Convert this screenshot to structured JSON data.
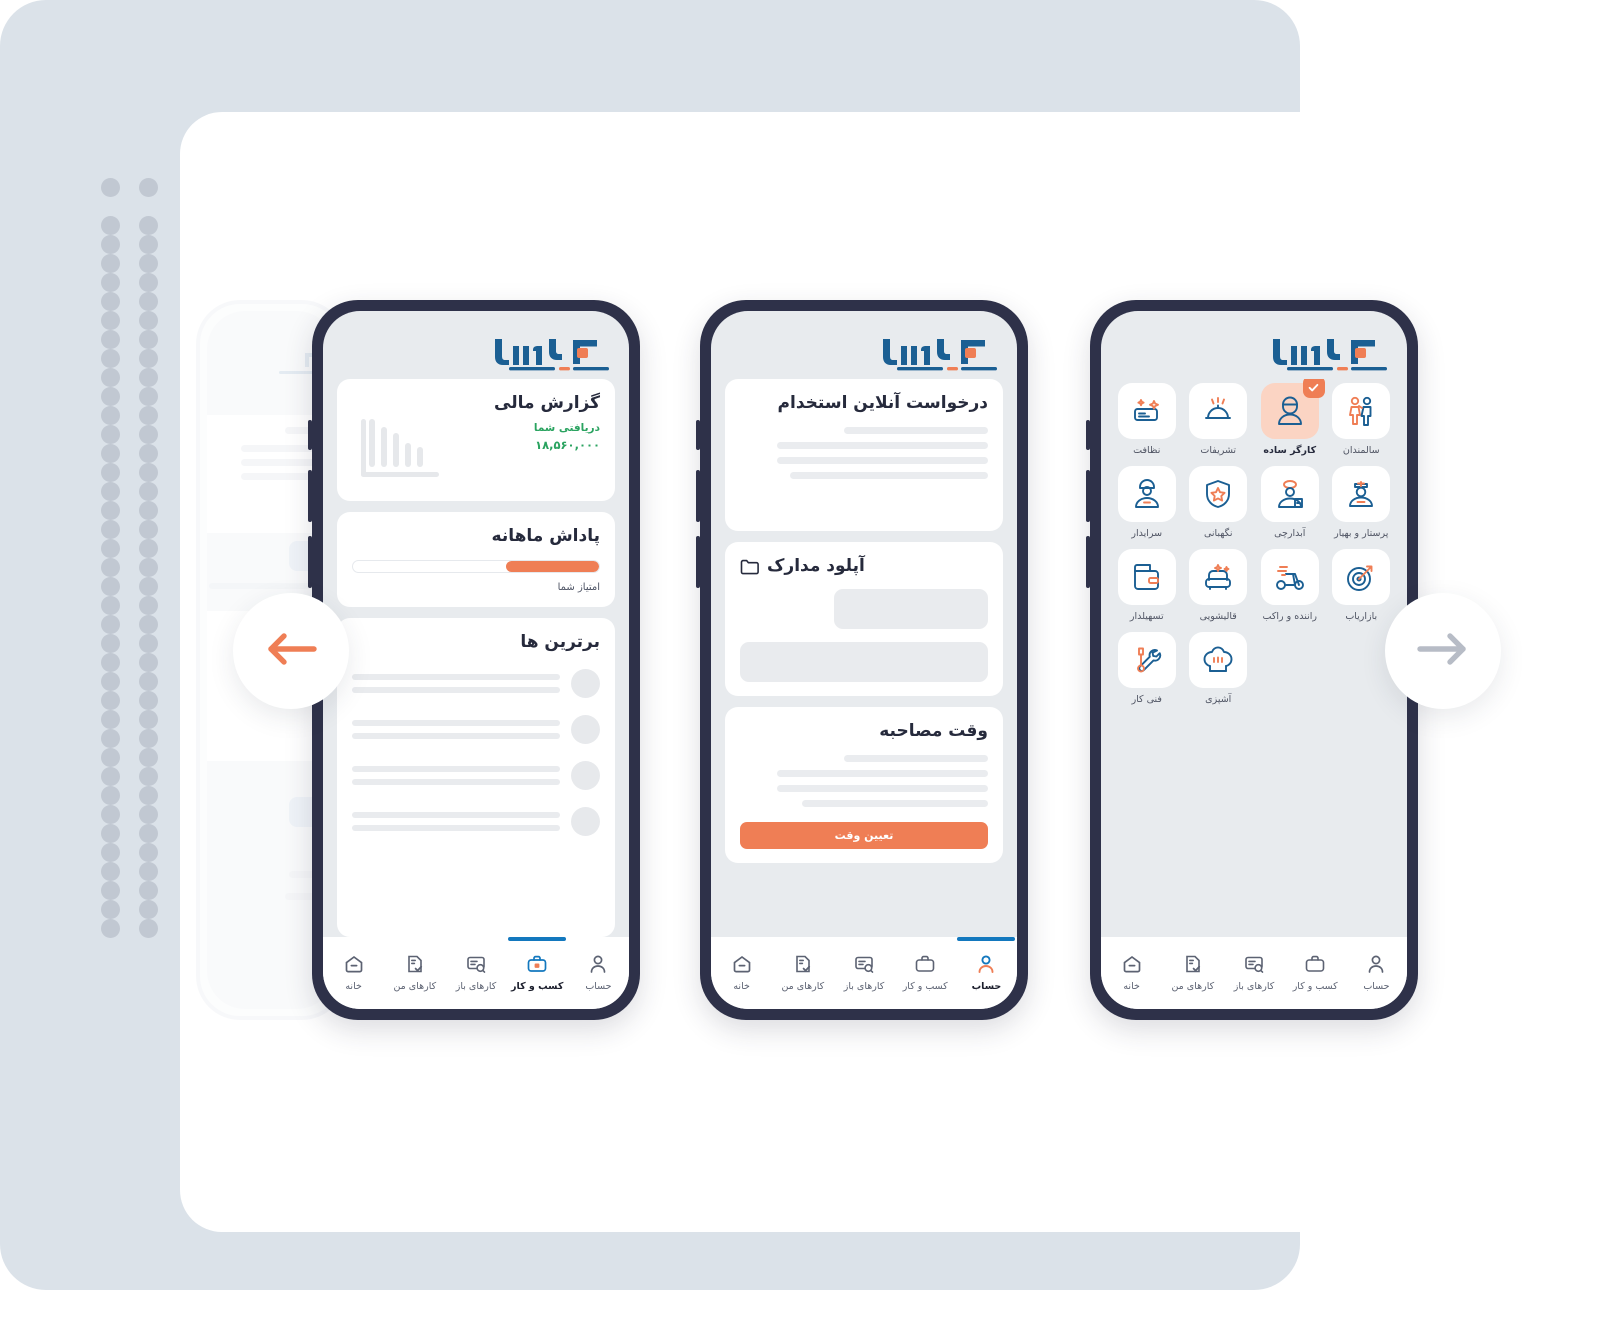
{
  "brand": {
    "name": "کارلاین",
    "colors": {
      "blue": "#1b5f93",
      "orange": "#ef7e55",
      "dark": "#2e3149",
      "green": "#2aa360"
    }
  },
  "carousel": {
    "prev_label": "قبلی",
    "next_label": "بعدی",
    "prev_icon": "arrow-left-icon",
    "next_icon": "arrow-right-icon"
  },
  "bottom_nav": {
    "items": [
      {
        "label": "حساب",
        "icon": "user-icon"
      },
      {
        "label": "کسب و کار",
        "icon": "briefcase-icon"
      },
      {
        "label": "کارهای باز",
        "icon": "document-search-icon"
      },
      {
        "label": "کارهای من",
        "icon": "document-check-icon"
      },
      {
        "label": "خانه",
        "icon": "home-icon"
      }
    ]
  },
  "screens": [
    {
      "id": "business-dashboard",
      "active_nav": "کسب و کار",
      "cards": [
        {
          "id": "financial-report",
          "title": "گزارش مالی",
          "subtitle": "دریافتی شما",
          "amount": "۱۸,۵۶۰,۰۰۰",
          "chart_icon": "bar-chart-icon"
        },
        {
          "id": "monthly-bonus",
          "title": "پاداش ماهانه",
          "progress_label": "امتیاز شما",
          "progress_percent": 38
        },
        {
          "id": "top-performers",
          "title": "برترین ها",
          "rows": 4
        }
      ]
    },
    {
      "id": "hiring-request",
      "active_nav": "حساب",
      "cards": [
        {
          "id": "online-hiring-request",
          "title": "درخواست آنلاین استخدام",
          "lines": 4
        },
        {
          "id": "upload-documents",
          "title": "آپلود مدارک",
          "icon": "folder-icon",
          "boxes": 2
        },
        {
          "id": "interview-time",
          "title": "وقت مصاحبه",
          "lines": 4,
          "button_label": "تعیین وقت"
        }
      ]
    },
    {
      "id": "service-categories",
      "active_nav": null,
      "categories": [
        {
          "label": "سالمندان",
          "icon": "elderly-care-icon",
          "selected": false
        },
        {
          "label": "کارگر ساده",
          "icon": "worker-icon",
          "selected": true
        },
        {
          "label": "تشریفات",
          "icon": "service-bell-icon",
          "selected": false
        },
        {
          "label": "نظافت",
          "icon": "cleaning-icon",
          "selected": false
        },
        {
          "label": "پرستار و بهیار",
          "icon": "nurse-icon",
          "selected": false
        },
        {
          "label": "آبدارچی",
          "icon": "tea-server-icon",
          "selected": false
        },
        {
          "label": "نگهبانی",
          "icon": "shield-badge-icon",
          "selected": false
        },
        {
          "label": "سرایدار",
          "icon": "caretaker-icon",
          "selected": false
        },
        {
          "label": "بازاریاب",
          "icon": "target-dart-icon",
          "selected": false
        },
        {
          "label": "راننده و راکب",
          "icon": "scooter-icon",
          "selected": false
        },
        {
          "label": "قالیشویی",
          "icon": "sofa-clean-icon",
          "selected": false
        },
        {
          "label": "تسهیلدار",
          "icon": "wallet-icon",
          "selected": false
        },
        {
          "label": "آشپزی",
          "icon": "chef-hat-icon",
          "selected": false
        },
        {
          "label": "فنی کار",
          "icon": "tools-icon",
          "selected": false
        }
      ],
      "selected_badge_icon": "check-icon"
    }
  ]
}
